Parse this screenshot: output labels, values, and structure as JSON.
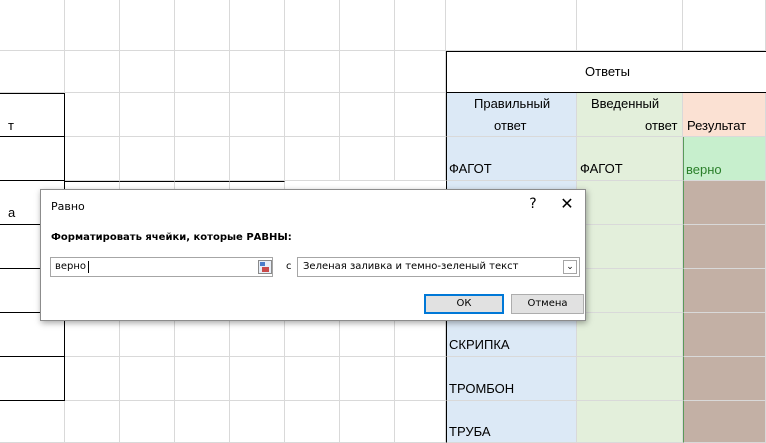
{
  "sheet": {
    "header_otvety": "Ответы",
    "col_correct_line1": "Правильный",
    "col_correct_line2": "ответ",
    "col_entered_line1": "Введенный",
    "col_entered_line2": "ответ",
    "col_result": "Результат",
    "left_t": "т",
    "left_a": "а",
    "rows": [
      {
        "correct": "ФАГОТ",
        "entered": "ФАГОТ",
        "result": "верно"
      },
      {
        "correct": "СКРИПКА",
        "entered": "",
        "result": ""
      },
      {
        "correct": "ТРОМБОН",
        "entered": "",
        "result": ""
      },
      {
        "correct": "ТРУБА",
        "entered": "",
        "result": ""
      }
    ]
  },
  "dialog": {
    "title": "Равно",
    "help": "?",
    "close": "✕",
    "label": "Форматировать ячейки, которые РАВНЫ:",
    "value": "верно",
    "with_label": "с",
    "format_selected": "Зеленая заливка и темно-зеленый текст",
    "ok_label": "ОК",
    "cancel_label": "Отмена"
  },
  "colors": {
    "correct_fill": "#dce9f6",
    "entered_fill": "#e3efdb",
    "result_header_fill": "#fbe1d3",
    "result_empty_fill": "#c3b0a5",
    "result_ok_fill": "#c7efcd",
    "ok_border": "#0078d7"
  },
  "icons": {
    "ref": "range-select-icon",
    "dropdown": "chevron-down-icon"
  }
}
